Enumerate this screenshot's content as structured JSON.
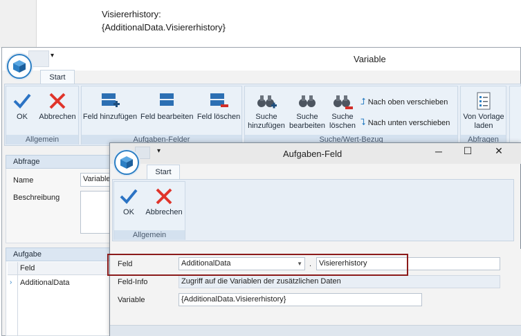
{
  "document": {
    "line1": "Visiererhistory:",
    "line2": "{AdditionalData.Visiererhistory}"
  },
  "variable_window": {
    "title": "Variable",
    "quick_access": "▾",
    "tab": "Start",
    "groups": {
      "allgemein": {
        "label": "Allgemein",
        "ok": "OK",
        "abbrechen": "Abbrechen"
      },
      "aufgaben_felder": {
        "label": "Aufgaben-Felder",
        "add": "Feld hinzufügen",
        "edit": "Feld bearbeiten",
        "delete": "Feld löschen"
      },
      "suche": {
        "label": "Suche/Wert-Bezug",
        "add_l1": "Suche",
        "add_l2": "hinzufügen",
        "edit_l1": "Suche",
        "edit_l2": "bearbeiten",
        "del_l1": "Suche",
        "del_l2": "löschen",
        "up": "Nach oben verschieben",
        "down": "Nach unten verschieben"
      },
      "abfragen": {
        "label": "Abfragen",
        "tpl_l1": "Von Vorlage",
        "tpl_l2": "laden"
      }
    },
    "abfrage_panel": {
      "title": "Abfrage",
      "name_label": "Name",
      "name_value": "Variable",
      "desc_label": "Beschreibung"
    },
    "aufgabe_panel": {
      "title": "Aufgabe",
      "col_feld": "Feld",
      "row1": "AdditionalData"
    }
  },
  "field_dialog": {
    "title": "Aufgaben-Feld",
    "quick_access": "▾",
    "tab": "Start",
    "ok": "OK",
    "abbrechen": "Abbrechen",
    "group_label": "Allgemein",
    "feld_label": "Feld",
    "feld_value": "AdditionalData",
    "separator": ".",
    "feld_sub_value": "Visiererhistory",
    "info_label": "Feld-Info",
    "info_value": "Zugriff auf die Variablen der zusätzlichen Daten",
    "variable_label": "Variable",
    "variable_value": "{AdditionalData.Visiererhistory}"
  },
  "colors": {
    "highlight": "#8b1a1a",
    "accent": "#2c7fc4",
    "ok": "#2b73c4",
    "cancel": "#e0342a"
  },
  "icons": [
    "app-cube-icon",
    "check-icon",
    "cross-icon",
    "field-add-icon",
    "field-edit-icon",
    "field-delete-icon",
    "binoculars-add-icon",
    "binoculars-edit-icon",
    "binoculars-delete-icon",
    "arrow-up-icon",
    "arrow-down-icon",
    "template-load-icon",
    "minimize-icon",
    "maximize-icon",
    "close-icon",
    "dropdown-arrow-icon"
  ]
}
